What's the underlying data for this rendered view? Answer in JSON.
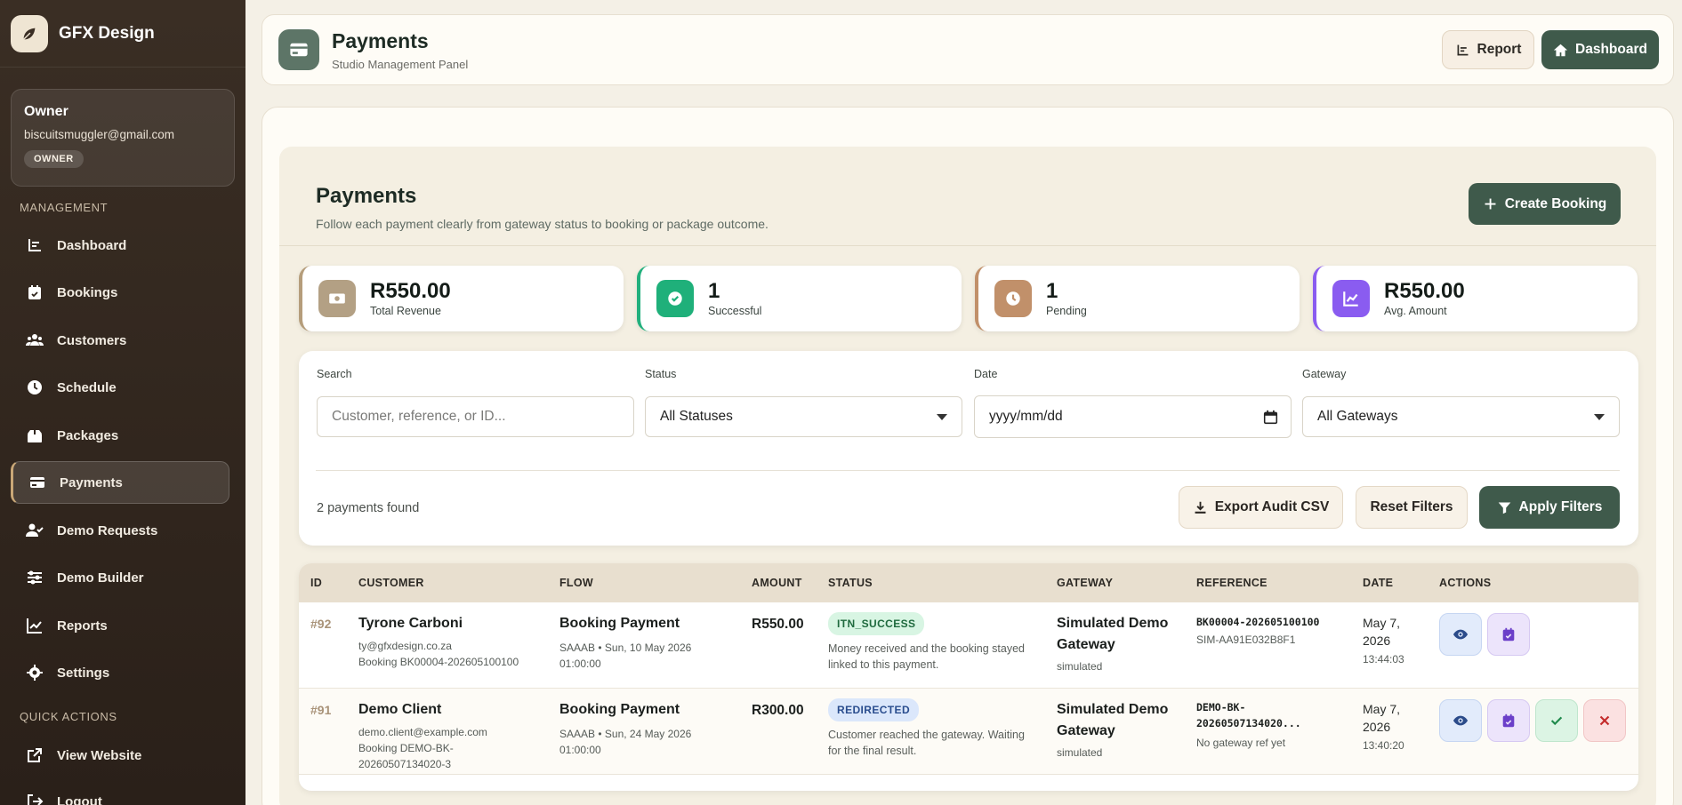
{
  "brand": {
    "name": "GFX Design",
    "icon": "leaf-icon"
  },
  "owner": {
    "title": "Owner",
    "email": "biscuitsmuggler@gmail.com",
    "badge": "OWNER"
  },
  "sidebar": {
    "management_label": "MANAGEMENT",
    "items": [
      {
        "label": "Dashboard",
        "icon": "chart-icon"
      },
      {
        "label": "Bookings",
        "icon": "calendar-check-icon"
      },
      {
        "label": "Customers",
        "icon": "users-icon"
      },
      {
        "label": "Schedule",
        "icon": "clock-icon"
      },
      {
        "label": "Packages",
        "icon": "box-icon"
      },
      {
        "label": "Payments",
        "icon": "card-icon",
        "active": true
      },
      {
        "label": "Demo Requests",
        "icon": "user-check-icon"
      },
      {
        "label": "Demo Builder",
        "icon": "sliders-icon"
      },
      {
        "label": "Reports",
        "icon": "line-chart-icon"
      },
      {
        "label": "Settings",
        "icon": "gear-icon"
      }
    ],
    "quick_label": "QUICK ACTIONS",
    "quick_items": [
      {
        "label": "View Website",
        "icon": "external-link-icon"
      },
      {
        "label": "Logout",
        "icon": "logout-icon"
      }
    ]
  },
  "header": {
    "title": "Payments",
    "subtitle": "Studio Management Panel",
    "report_label": "Report",
    "dashboard_label": "Dashboard"
  },
  "page": {
    "title": "Payments",
    "subtitle": "Follow each payment clearly from gateway status to booking or package outcome.",
    "create_label": "Create Booking"
  },
  "stats": [
    {
      "value": "R550.00",
      "label": "Total Revenue",
      "color": "#b59d7b"
    },
    {
      "value": "1",
      "label": "Successful",
      "color": "#22b07d"
    },
    {
      "value": "1",
      "label": "Pending",
      "color": "#c1906a"
    },
    {
      "value": "R550.00",
      "label": "Avg. Amount",
      "color": "#8a5cf0"
    }
  ],
  "filters": {
    "search_label": "Search",
    "search_placeholder": "Customer, reference, or ID...",
    "status_label": "Status",
    "status_value": "All Statuses",
    "date_label": "Date",
    "date_value": "yyyy/mm/dd",
    "gateway_label": "Gateway",
    "gateway_value": "All Gateways",
    "found_text": "2 payments found",
    "export_label": "Export Audit CSV",
    "reset_label": "Reset Filters",
    "apply_label": "Apply Filters"
  },
  "table": {
    "headers": [
      "ID",
      "CUSTOMER",
      "FLOW",
      "AMOUNT",
      "STATUS",
      "GATEWAY",
      "REFERENCE",
      "DATE",
      "ACTIONS"
    ],
    "rows": [
      {
        "id": "#92",
        "customer": "Tyrone Carboni",
        "email": "ty@gfxdesign.co.za",
        "booking": "Booking BK00004-202605100100",
        "flow": "Booking Payment",
        "flow_detail_1": "SAAAB • Sun, 10 May 2026",
        "flow_detail_2": "01:00:00",
        "amount": "R550.00",
        "status": "ITN_SUCCESS",
        "status_note_1": "Money received and the booking stayed",
        "status_note_2": "linked to this payment.",
        "gateway_1": "Simulated Demo",
        "gateway_2": "Gateway",
        "gateway_mode": "simulated",
        "reference": "BK00004-202605100100",
        "gateway_ref": "SIM-AA91E032B8F1",
        "date_1": "May 7,",
        "date_2": "2026",
        "time": "13:44:03"
      },
      {
        "id": "#91",
        "customer": "Demo Client",
        "email": "demo.client@example.com",
        "booking_1": "Booking DEMO-BK-",
        "booking_2": "20260507134020-3",
        "flow": "Booking Payment",
        "flow_detail_1": "SAAAB • Sun, 24 May 2026",
        "flow_detail_2": "01:00:00",
        "amount": "R300.00",
        "status": "REDIRECTED",
        "status_note_1": "Customer reached the gateway. Waiting",
        "status_note_2": "for the final result.",
        "gateway_1": "Simulated Demo",
        "gateway_2": "Gateway",
        "gateway_mode": "simulated",
        "reference_1": "DEMO-BK-",
        "reference_2": "20260507134020...",
        "gateway_ref": "No gateway ref yet",
        "date_1": "May 7,",
        "date_2": "2026",
        "time": "13:40:20"
      }
    ]
  },
  "colors": {
    "primary": "#3f5a4b",
    "sidebar": "#2f251d",
    "background": "#f4f0e6"
  }
}
